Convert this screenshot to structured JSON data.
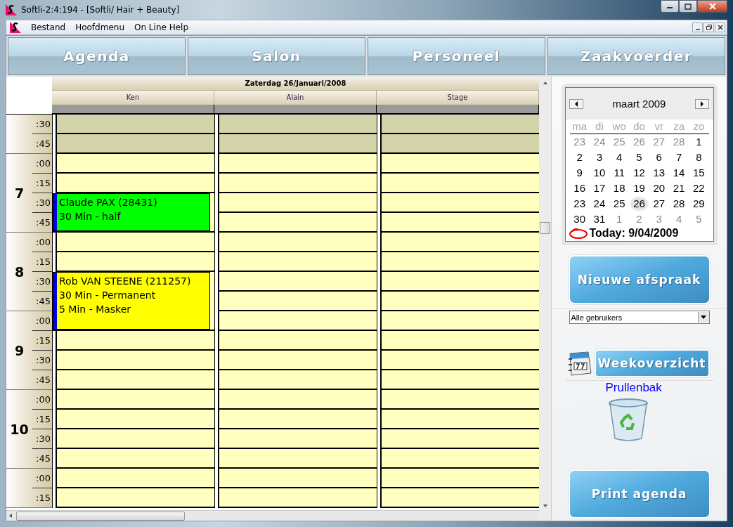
{
  "window": {
    "title": "Softli-2:4:194 - [Softli/ Hair + Beauty]"
  },
  "menu": [
    "Bestand",
    "Hoofdmenu",
    "On Line Help"
  ],
  "tabs": [
    "Agenda",
    "Salon",
    "Personeel",
    "Zaakvoerder"
  ],
  "agenda": {
    "date": "Zaterdag 26/Januari/2008",
    "hours": [
      {
        "slots": [
          {
            "label": ":30",
            "closed": true
          },
          {
            "label": ":45",
            "closed": true
          }
        ]
      },
      {
        "hour": "7",
        "slots": [
          {
            "label": ":00",
            "closed": false
          },
          {
            "label": ":15",
            "closed": false
          },
          {
            "label": ":30",
            "closed": false
          },
          {
            "label": ":45",
            "closed": false
          }
        ]
      },
      {
        "hour": "8",
        "slots": [
          {
            "label": ":00",
            "closed": false
          },
          {
            "label": ":15",
            "closed": false
          },
          {
            "label": ":30",
            "closed": false
          },
          {
            "label": ":45",
            "closed": false
          }
        ]
      },
      {
        "hour": "9",
        "slots": [
          {
            "label": ":00",
            "closed": false
          },
          {
            "label": ":15",
            "closed": false
          },
          {
            "label": ":30",
            "closed": false
          },
          {
            "label": ":45",
            "closed": false
          }
        ]
      },
      {
        "hour": "10",
        "slots": [
          {
            "label": ":00",
            "closed": false
          },
          {
            "label": ":15",
            "closed": false
          },
          {
            "label": ":30",
            "closed": false
          },
          {
            "label": ":45",
            "closed": false
          }
        ]
      },
      {
        "slots": [
          {
            "label": ":00",
            "closed": false
          },
          {
            "label": ":15",
            "closed": false
          }
        ]
      }
    ],
    "columns": [
      {
        "name": "Ken",
        "cells": [
          {
            "kind": "free"
          },
          {
            "kind": "free"
          },
          {
            "kind": "free"
          },
          {
            "kind": "free"
          },
          {
            "kind": "appointment",
            "color": "#00ff00",
            "lines": [
              "Claude PAX (28431)",
              "30 Min - half"
            ]
          },
          {
            "kind": "continued"
          },
          {
            "kind": "free"
          },
          {
            "kind": "free"
          },
          {
            "kind": "appointment",
            "color": "#ffff00",
            "lines": [
              "Rob VAN STEENE (211257)",
              "30 Min - Permanent",
              "5 Min - Masker"
            ]
          },
          {
            "kind": "continued"
          },
          {
            "kind": "continued"
          },
          {
            "kind": "free"
          },
          {
            "kind": "free"
          },
          {
            "kind": "free"
          },
          {
            "kind": "free"
          },
          {
            "kind": "free"
          },
          {
            "kind": "free"
          },
          {
            "kind": "free"
          },
          {
            "kind": "free"
          },
          {
            "kind": "free"
          }
        ]
      },
      {
        "name": "Alain"
      },
      {
        "name": "Stage"
      }
    ]
  },
  "calendar": {
    "month": "maart 2009",
    "weekdays": [
      "ma",
      "di",
      "wo",
      "do",
      "vr",
      "za",
      "zo"
    ],
    "weeks": [
      [
        {
          "day": "23",
          "kind": "other"
        },
        {
          "day": "24",
          "kind": "other"
        },
        {
          "day": "25",
          "kind": "other"
        },
        {
          "day": "26",
          "kind": "other"
        },
        {
          "day": "27",
          "kind": "other"
        },
        {
          "day": "28",
          "kind": "other"
        },
        {
          "day": "1",
          "kind": "month"
        }
      ],
      [
        {
          "day": "2",
          "kind": "month"
        },
        {
          "day": "3",
          "kind": "month"
        },
        {
          "day": "4",
          "kind": "month"
        },
        {
          "day": "5",
          "kind": "month"
        },
        {
          "day": "6",
          "kind": "month"
        },
        {
          "day": "7",
          "kind": "month"
        },
        {
          "day": "8",
          "kind": "month"
        }
      ],
      [
        {
          "day": "9",
          "kind": "month"
        },
        {
          "day": "10",
          "kind": "month"
        },
        {
          "day": "11",
          "kind": "month"
        },
        {
          "day": "12",
          "kind": "month"
        },
        {
          "day": "13",
          "kind": "month"
        },
        {
          "day": "14",
          "kind": "month"
        },
        {
          "day": "15",
          "kind": "month"
        }
      ],
      [
        {
          "day": "16",
          "kind": "month"
        },
        {
          "day": "17",
          "kind": "month"
        },
        {
          "day": "18",
          "kind": "month"
        },
        {
          "day": "19",
          "kind": "month"
        },
        {
          "day": "20",
          "kind": "month"
        },
        {
          "day": "21",
          "kind": "month"
        },
        {
          "day": "22",
          "kind": "month"
        }
      ],
      [
        {
          "day": "23",
          "kind": "month"
        },
        {
          "day": "24",
          "kind": "month"
        },
        {
          "day": "25",
          "kind": "month"
        },
        {
          "day": "26",
          "kind": "highlighted"
        },
        {
          "day": "27",
          "kind": "month"
        },
        {
          "day": "28",
          "kind": "month"
        },
        {
          "day": "29",
          "kind": "month"
        }
      ],
      [
        {
          "day": "30",
          "kind": "month"
        },
        {
          "day": "31",
          "kind": "month"
        },
        {
          "day": "1",
          "kind": "other"
        },
        {
          "day": "2",
          "kind": "other"
        },
        {
          "day": "3",
          "kind": "other"
        },
        {
          "day": "4",
          "kind": "other"
        },
        {
          "day": "5",
          "kind": "other"
        }
      ]
    ],
    "today": "Today: 9/04/2009"
  },
  "sidebar": {
    "new_button": "Nieuwe afspraak",
    "user_filter": "Alle gebruikers",
    "week_button": "Weekoverzicht",
    "trash_label": "Prullenbak",
    "print_button": "Print agenda"
  }
}
